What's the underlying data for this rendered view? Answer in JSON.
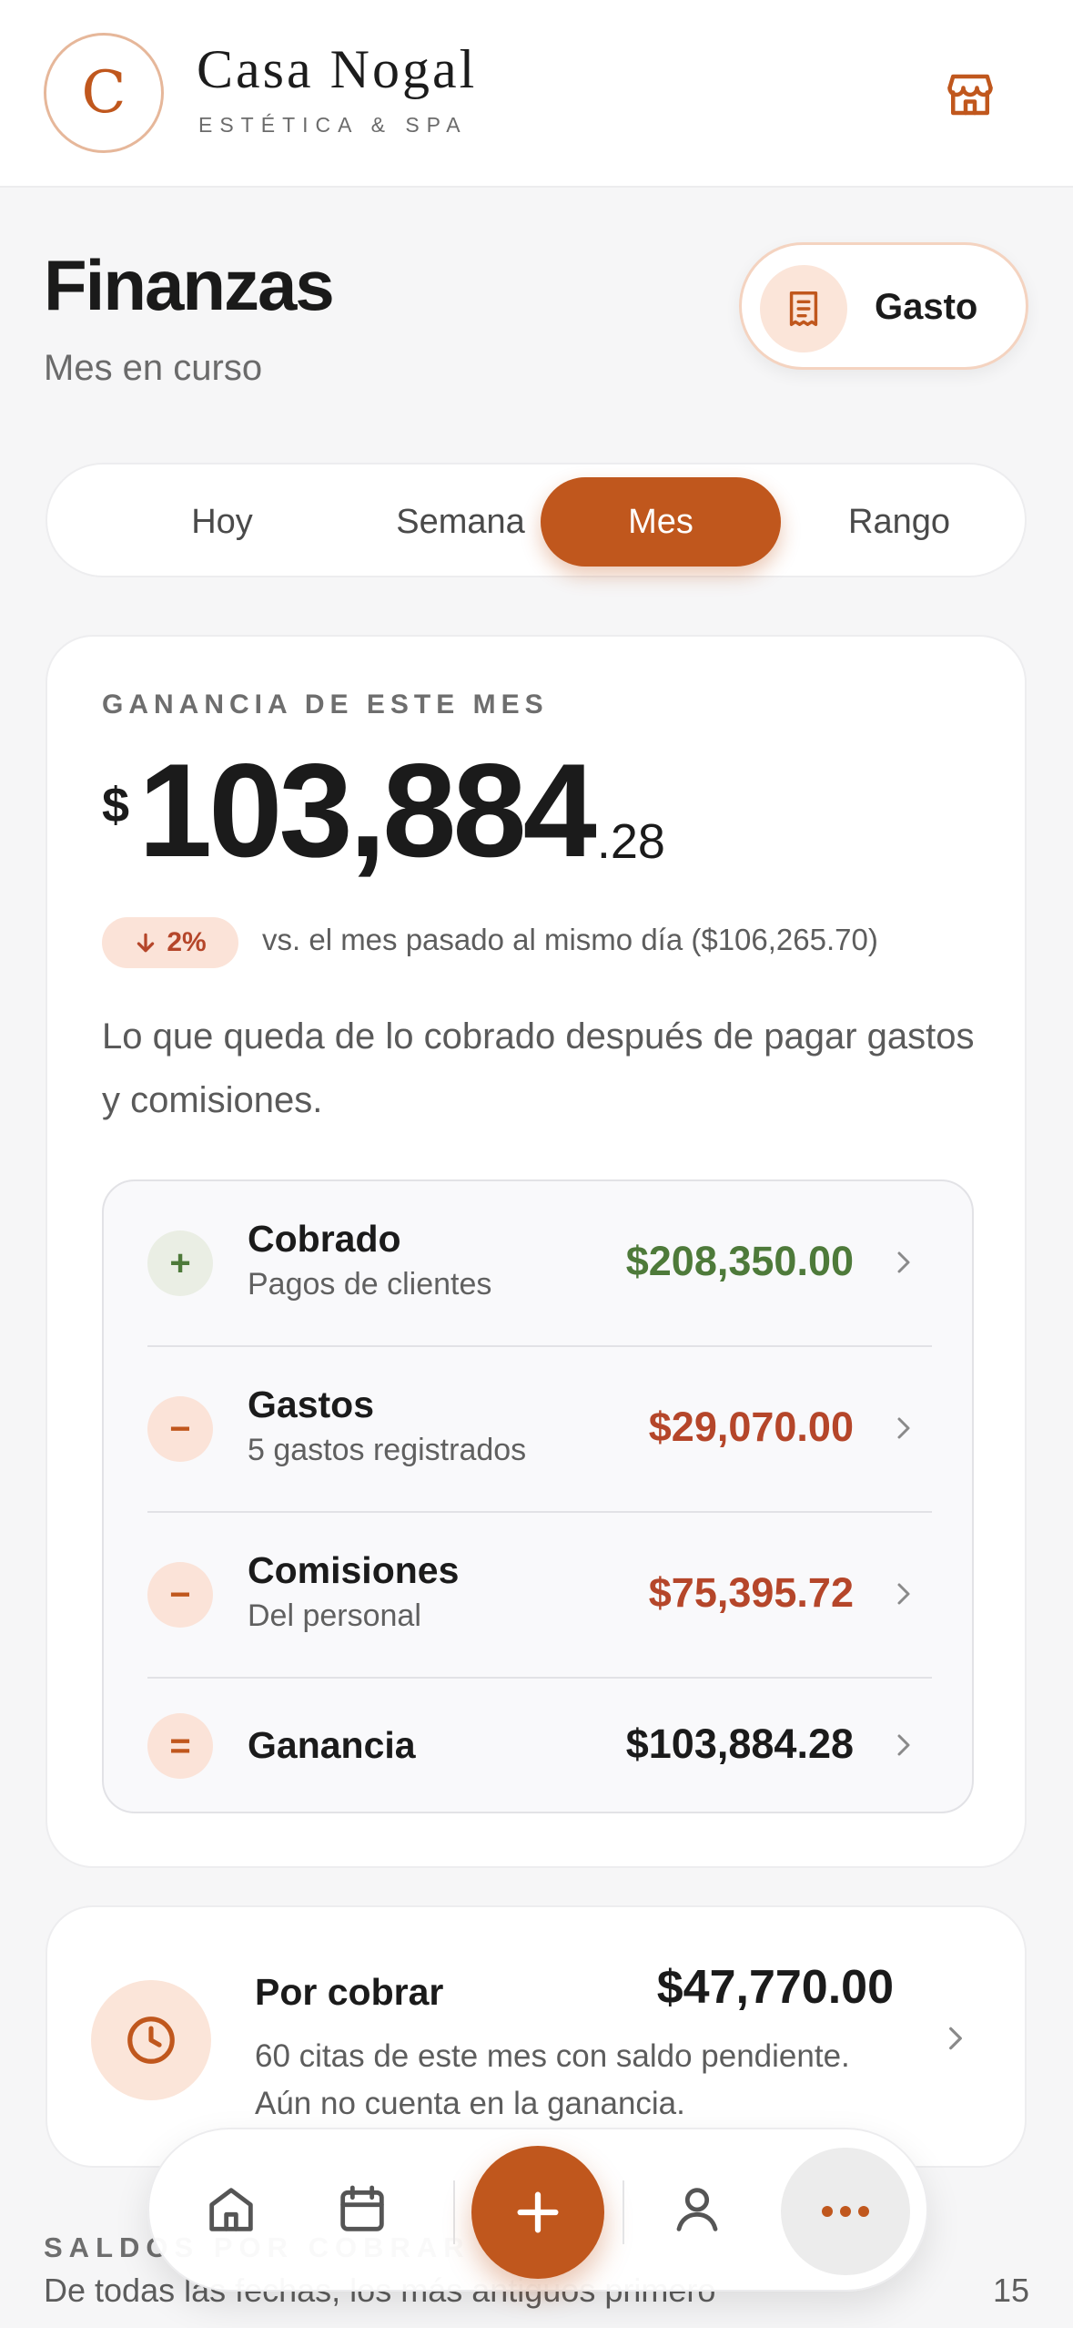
{
  "brand": {
    "logo_letter": "C",
    "name": "Casa Nogal",
    "tagline": "ESTÉTICA & SPA"
  },
  "header": {
    "title": "Finanzas",
    "subtitle": "Mes en curso",
    "expense_button_label": "Gasto"
  },
  "tabs": [
    {
      "label": "Hoy",
      "active": false
    },
    {
      "label": "Semana",
      "active": false
    },
    {
      "label": "Mes",
      "active": true
    },
    {
      "label": "Rango",
      "active": false
    }
  ],
  "profit": {
    "eyebrow": "GANANCIA DE ESTE MES",
    "currency": "$",
    "integer": "103,884",
    "decimal": ".28",
    "delta": "2%",
    "delta_direction": "down",
    "comparison": "vs. el mes pasado al mismo día ($106,265.70)",
    "description": "Lo que queda de lo cobrado después de pagar gastos y comisiones."
  },
  "breakdown": [
    {
      "sign": "+",
      "title": "Cobrado",
      "subtitle": "Pagos de clientes",
      "value": "$208,350.00",
      "color": "#4e7a3a"
    },
    {
      "sign": "−",
      "title": "Gastos",
      "subtitle": "5 gastos registrados",
      "value": "$29,070.00",
      "color": "#b5462a"
    },
    {
      "sign": "−",
      "title": "Comisiones",
      "subtitle": "Del personal",
      "value": "$75,395.72",
      "color": "#b5462a"
    },
    {
      "sign": "=",
      "title": "Ganancia",
      "subtitle": "",
      "value": "$103,884.28",
      "color": "#1b1b1b"
    }
  ],
  "receivable": {
    "title": "Por cobrar",
    "value": "$47,770.00",
    "description": "60 citas de este mes con saldo pendiente. Aún no cuenta en la ganancia."
  },
  "balances_section": {
    "eyebrow": "SALDOS POR COBRAR",
    "subtitle": "De todas las fechas, los más antiguos primero",
    "count": "15"
  },
  "colors": {
    "accent": "#c0571d",
    "positive": "#4e7a3a",
    "negative": "#b5462a"
  },
  "nav_icons": [
    "home-icon",
    "calendar-icon",
    "plus-icon",
    "user-icon",
    "more-icon"
  ]
}
